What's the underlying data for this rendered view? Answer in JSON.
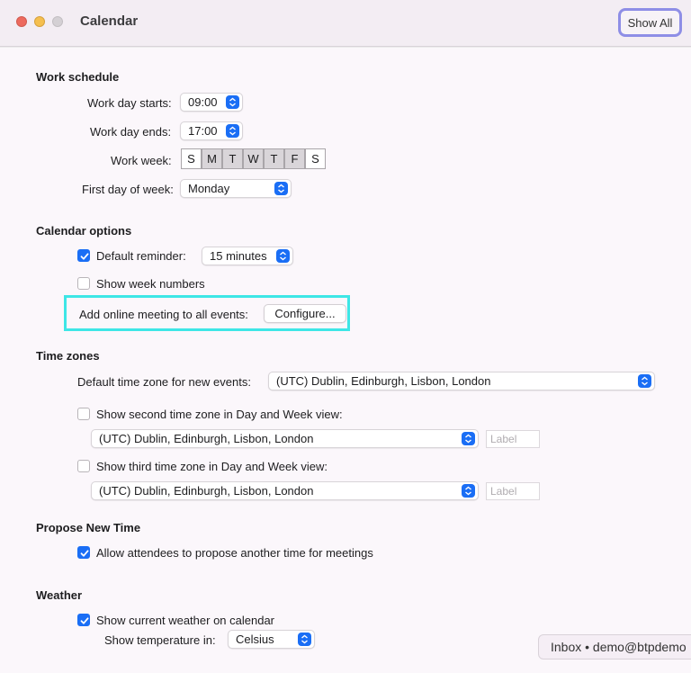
{
  "window": {
    "title": "Calendar",
    "show_all": "Show All"
  },
  "work_schedule": {
    "heading": "Work schedule",
    "day_starts_label": "Work day starts:",
    "day_starts_value": "09:00",
    "day_ends_label": "Work day ends:",
    "day_ends_value": "17:00",
    "work_week_label": "Work week:",
    "days": [
      {
        "letter": "S",
        "selected": false
      },
      {
        "letter": "M",
        "selected": true
      },
      {
        "letter": "T",
        "selected": true
      },
      {
        "letter": "W",
        "selected": true
      },
      {
        "letter": "T",
        "selected": true
      },
      {
        "letter": "F",
        "selected": true
      },
      {
        "letter": "S",
        "selected": false
      }
    ],
    "first_day_label": "First day of week:",
    "first_day_value": "Monday"
  },
  "calendar_options": {
    "heading": "Calendar options",
    "default_reminder_label": "Default reminder:",
    "default_reminder_checked": true,
    "default_reminder_value": "15 minutes",
    "week_numbers_label": "Show week numbers",
    "week_numbers_checked": false,
    "online_meeting_label": "Add online meeting to all events:",
    "configure_button": "Configure..."
  },
  "time_zones": {
    "heading": "Time zones",
    "default_tz_label": "Default time zone for new events:",
    "default_tz_value": "(UTC) Dublin, Edinburgh, Lisbon, London",
    "second_tz_label": "Show second time zone in Day and Week view:",
    "second_tz_checked": false,
    "second_tz_value": "(UTC) Dublin, Edinburgh, Lisbon, London",
    "second_tz_placeholder": "Label",
    "third_tz_label": "Show third time zone in Day and Week view:",
    "third_tz_checked": false,
    "third_tz_value": "(UTC) Dublin, Edinburgh, Lisbon, London",
    "third_tz_placeholder": "Label"
  },
  "propose_new_time": {
    "heading": "Propose New Time",
    "allow_label": "Allow attendees to propose another time for meetings",
    "allow_checked": true
  },
  "weather": {
    "heading": "Weather",
    "show_weather_label": "Show current weather on calendar",
    "show_weather_checked": true,
    "temperature_label": "Show temperature in:",
    "temperature_value": "Celsius"
  },
  "status_pill": {
    "text": "Inbox • demo@btpdemo"
  },
  "colors": {
    "accent": "#1a6ef5",
    "highlight": "#3ee6e6",
    "focus_ring": "#8e8ee6"
  },
  "icons": [
    "close-icon",
    "minimize-icon",
    "zoom-icon",
    "stepper-arrows-icon",
    "checkmark-icon"
  ]
}
